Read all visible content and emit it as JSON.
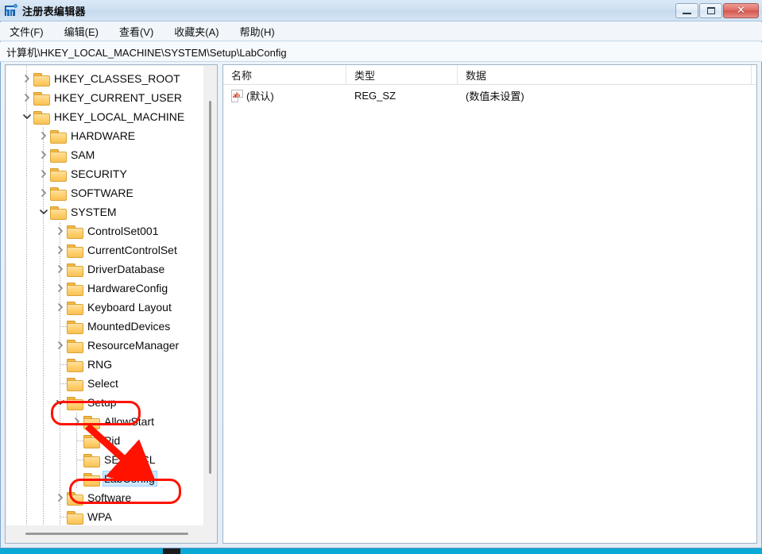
{
  "window": {
    "title": "注册表编辑器",
    "app_icon": "registry-editor-icon",
    "buttons": {
      "minimize": "–",
      "maximize": "□",
      "close": "✕"
    }
  },
  "menubar": {
    "items": [
      {
        "label": "文件(F)",
        "name": "menu-file"
      },
      {
        "label": "编辑(E)",
        "name": "menu-edit"
      },
      {
        "label": "查看(V)",
        "name": "menu-view"
      },
      {
        "label": "收藏夹(A)",
        "name": "menu-favorites"
      },
      {
        "label": "帮助(H)",
        "name": "menu-help"
      }
    ]
  },
  "address": {
    "path": "计算机\\HKEY_LOCAL_MACHINE\\SYSTEM\\Setup\\LabConfig"
  },
  "tree": {
    "nodes": [
      {
        "label": "HKEY_CLASSES_ROOT",
        "depth": 0,
        "state": "collapsed",
        "selected": false
      },
      {
        "label": "HKEY_CURRENT_USER",
        "depth": 0,
        "state": "collapsed",
        "selected": false
      },
      {
        "label": "HKEY_LOCAL_MACHINE",
        "depth": 0,
        "state": "expanded",
        "selected": false
      },
      {
        "label": "HARDWARE",
        "depth": 1,
        "state": "collapsed",
        "selected": false
      },
      {
        "label": "SAM",
        "depth": 1,
        "state": "collapsed",
        "selected": false
      },
      {
        "label": "SECURITY",
        "depth": 1,
        "state": "collapsed",
        "selected": false
      },
      {
        "label": "SOFTWARE",
        "depth": 1,
        "state": "collapsed",
        "selected": false
      },
      {
        "label": "SYSTEM",
        "depth": 1,
        "state": "expanded",
        "selected": false
      },
      {
        "label": "ControlSet001",
        "depth": 2,
        "state": "collapsed",
        "selected": false
      },
      {
        "label": "CurrentControlSet",
        "depth": 2,
        "state": "collapsed",
        "selected": false
      },
      {
        "label": "DriverDatabase",
        "depth": 2,
        "state": "collapsed",
        "selected": false
      },
      {
        "label": "HardwareConfig",
        "depth": 2,
        "state": "collapsed",
        "selected": false
      },
      {
        "label": "Keyboard Layout",
        "depth": 2,
        "state": "collapsed",
        "selected": false
      },
      {
        "label": "MountedDevices",
        "depth": 2,
        "state": "leaf",
        "selected": false
      },
      {
        "label": "ResourceManager",
        "depth": 2,
        "state": "collapsed",
        "selected": false
      },
      {
        "label": "RNG",
        "depth": 2,
        "state": "leaf",
        "selected": false
      },
      {
        "label": "Select",
        "depth": 2,
        "state": "leaf",
        "selected": false
      },
      {
        "label": "Setup",
        "depth": 2,
        "state": "expanded",
        "selected": false
      },
      {
        "label": "AllowStart",
        "depth": 3,
        "state": "collapsed",
        "selected": false
      },
      {
        "label": "Pid",
        "depth": 3,
        "state": "leaf",
        "selected": false
      },
      {
        "label": "SETUPCL",
        "depth": 3,
        "state": "leaf",
        "selected": false
      },
      {
        "label": "LabConfig",
        "depth": 3,
        "state": "leaf",
        "selected": true
      },
      {
        "label": "Software",
        "depth": 2,
        "state": "collapsed",
        "selected": false
      },
      {
        "label": "WPA",
        "depth": 2,
        "state": "leaf",
        "selected": false
      }
    ]
  },
  "list": {
    "columns": [
      {
        "label": "名称",
        "name": "column-name"
      },
      {
        "label": "类型",
        "name": "column-type"
      },
      {
        "label": "数据",
        "name": "column-data"
      }
    ],
    "rows": [
      {
        "icon": "string-value-icon",
        "icon_text": "ab",
        "name": "(默认)",
        "type": "REG_SZ",
        "data": "(数值未设置)"
      }
    ]
  },
  "annotations": {
    "box_setup_label": "Setup",
    "box_labconfig_label": "LabConfig",
    "arrow": "red-arrow-down-right",
    "color": "#ff1200"
  },
  "colors": {
    "selection": "#cce8ff",
    "annotation_red": "#ff1200",
    "title_gradient_top": "#dbe9f7",
    "folder_yellow": "#ffcf6b",
    "taskbar_strip": "#0aa9d6"
  }
}
